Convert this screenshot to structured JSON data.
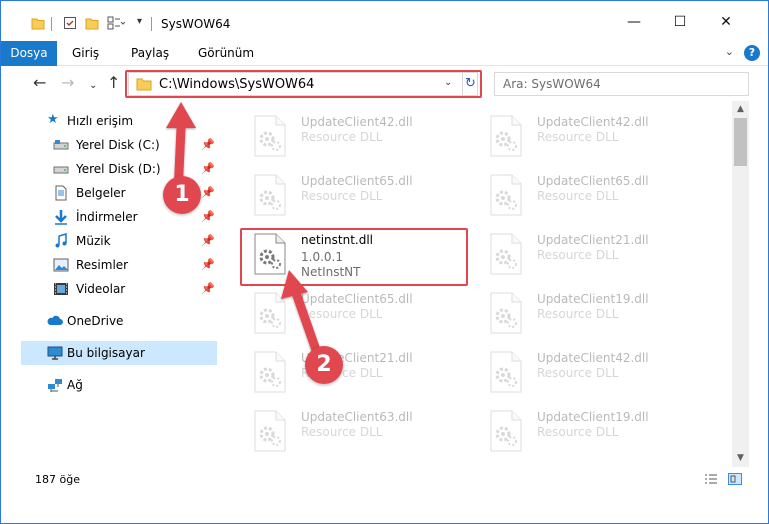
{
  "window": {
    "title": "SysWOW64",
    "controls": {
      "minimize": "—",
      "maximize": "☐",
      "close": "✕"
    }
  },
  "ribbon": {
    "file_tab": "Dosya",
    "tabs": [
      "Giriş",
      "Paylaş",
      "Görünüm"
    ],
    "help": "?"
  },
  "address": {
    "path": "C:\\Windows\\SysWOW64",
    "search_placeholder": "Ara: SysWOW64"
  },
  "nav": {
    "quick_access": "Hızlı erişim",
    "items": [
      {
        "label": "Yerel Disk (C:)",
        "icon": "drive-icon",
        "pinned": true
      },
      {
        "label": "Yerel Disk (D:)",
        "icon": "drive-icon",
        "pinned": true
      },
      {
        "label": "Belgeler",
        "icon": "documents-icon",
        "pinned": true
      },
      {
        "label": "İndirmeler",
        "icon": "download-icon",
        "pinned": true
      },
      {
        "label": "Müzik",
        "icon": "music-icon",
        "pinned": true
      },
      {
        "label": "Resimler",
        "icon": "pictures-icon",
        "pinned": true
      },
      {
        "label": "Videolar",
        "icon": "videos-icon",
        "pinned": true
      }
    ],
    "onedrive": "OneDrive",
    "this_pc": "Bu bilgisayar",
    "network": "Ağ"
  },
  "files": {
    "left_column": [
      {
        "name": "UpdateClient42.dll",
        "sub": "Resource DLL"
      },
      {
        "name": "UpdateClient65.dll",
        "sub": "Resource DLL"
      },
      {
        "name": "netinstnt.dll",
        "version": "1.0.0.1",
        "sub": "NetInstNT",
        "highlighted": true
      },
      {
        "name": "UpdateClient65.dll",
        "sub": "Resource DLL"
      },
      {
        "name": "UpdateClient21.dll",
        "sub": "Resource DLL"
      },
      {
        "name": "UpdateClient63.dll",
        "sub": "Resource DLL"
      }
    ],
    "right_column": [
      {
        "name": "UpdateClient42.dll",
        "sub": "Resource DLL"
      },
      {
        "name": "UpdateClient65.dll",
        "sub": "Resource DLL"
      },
      {
        "name": "UpdateClient21.dll",
        "sub": "Resource DLL"
      },
      {
        "name": "UpdateClient19.dll",
        "sub": "Resource DLL"
      },
      {
        "name": "UpdateClient42.dll",
        "sub": "Resource DLL"
      },
      {
        "name": "UpdateClient19.dll",
        "sub": "Resource DLL"
      }
    ]
  },
  "status": {
    "count": "187 öğe"
  },
  "callouts": [
    "1",
    "2"
  ],
  "colors": {
    "accent": "#1979ca",
    "highlight": "#e0474f",
    "selected": "#cce8ff"
  }
}
